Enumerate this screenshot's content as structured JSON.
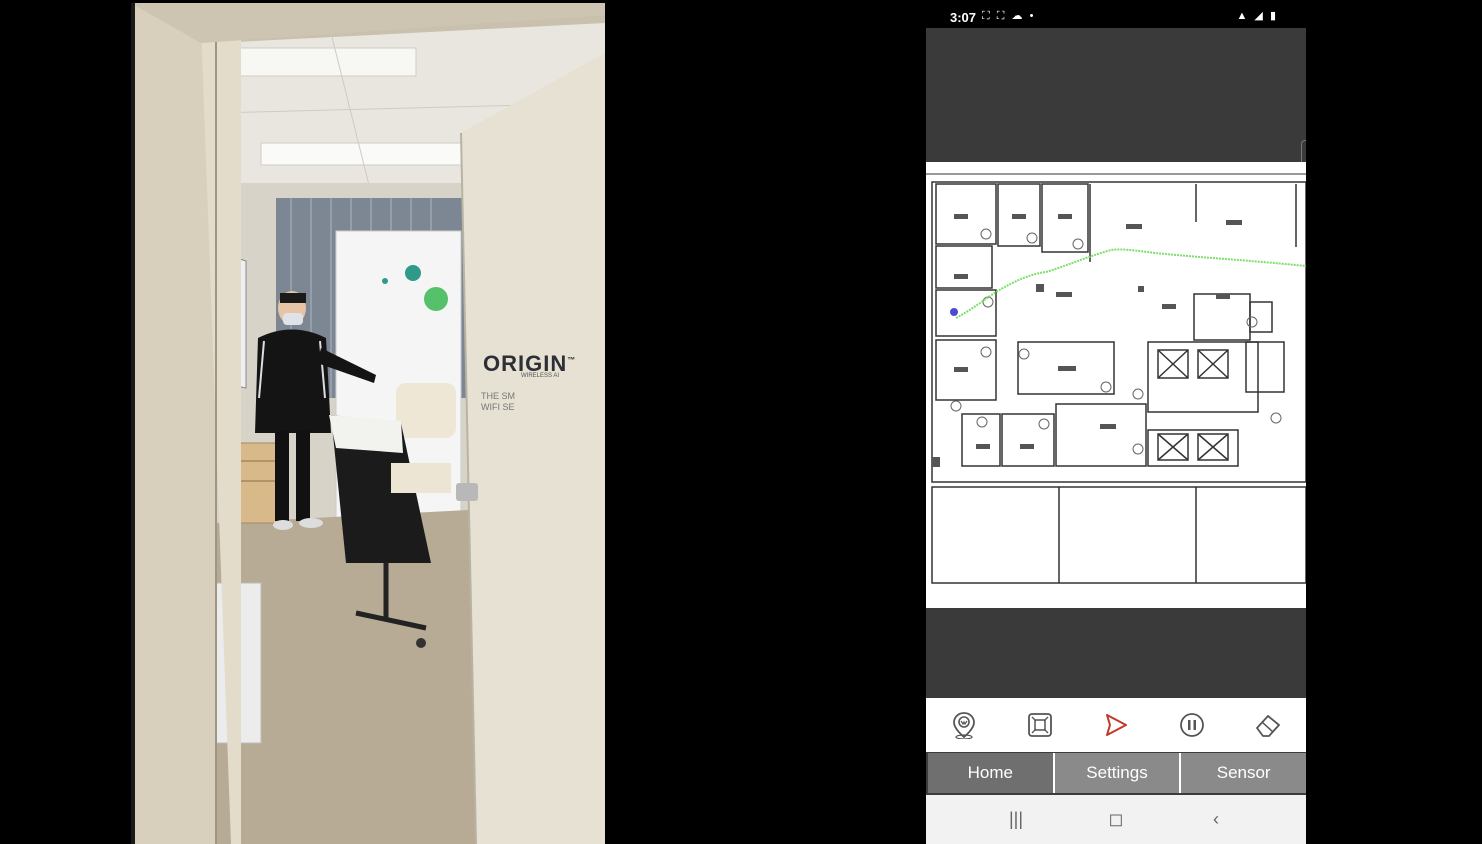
{
  "video": {
    "banner_brand": "ORIGIN",
    "banner_trademark": "™",
    "banner_subtitle": "WIRELESS AI",
    "banner_tagline_line1": "THE SM",
    "banner_tagline_line2": "WIFI SE"
  },
  "phone": {
    "status": {
      "time": "3:07",
      "left_icons": "⛶ ⛶ ☁ •",
      "right_icons": "▲ ◢ ▮"
    },
    "toolbar": {
      "icons": [
        "location-wifi-icon",
        "fit-screen-icon",
        "send-icon",
        "pause-icon",
        "eraser-icon"
      ],
      "accent_color": "#c0392b"
    },
    "tabs": [
      {
        "label": "Home",
        "active": true
      },
      {
        "label": "Settings",
        "active": false
      },
      {
        "label": "Sensor",
        "active": false
      }
    ],
    "navbar": {
      "recents": "|||",
      "home": "◻",
      "back": "‹"
    },
    "path_color": "#7be06a"
  }
}
